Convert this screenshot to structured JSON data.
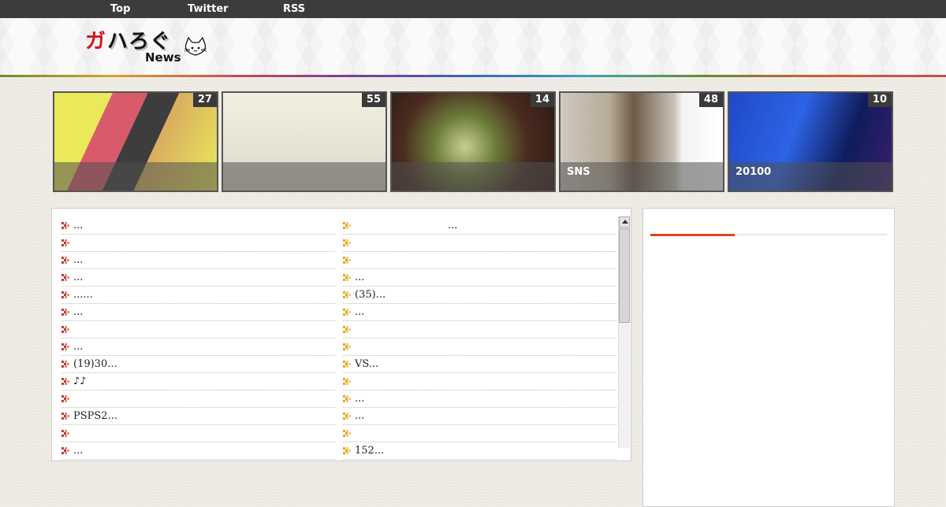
{
  "nav": {
    "items": [
      "Top",
      "Twitter",
      "RSS"
    ]
  },
  "logo": {
    "main_red": "ガ",
    "main_rest": "ハろぐ",
    "sub": "News"
  },
  "features": [
    {
      "count": "27",
      "caption": ""
    },
    {
      "count": "55",
      "caption": ""
    },
    {
      "count": "14",
      "caption": ""
    },
    {
      "count": "48",
      "caption": "SNS"
    },
    {
      "count": "10",
      "caption": "20100"
    }
  ],
  "list_left": [
    "...",
    "",
    "...",
    "...",
    "......",
    "...",
    "",
    "...",
    "(19)30...",
    "♪♪",
    "",
    "PSPS2...",
    "",
    "..."
  ],
  "list_right": [
    "...",
    "",
    "",
    "...",
    "(35)...",
    "...",
    "",
    "",
    "VS...",
    "",
    "...",
    "...",
    "",
    "152..."
  ],
  "colors": {
    "mark_left": "#c0392b",
    "mark_right": "#e2a51e",
    "tab_accent": "#e0441c"
  }
}
